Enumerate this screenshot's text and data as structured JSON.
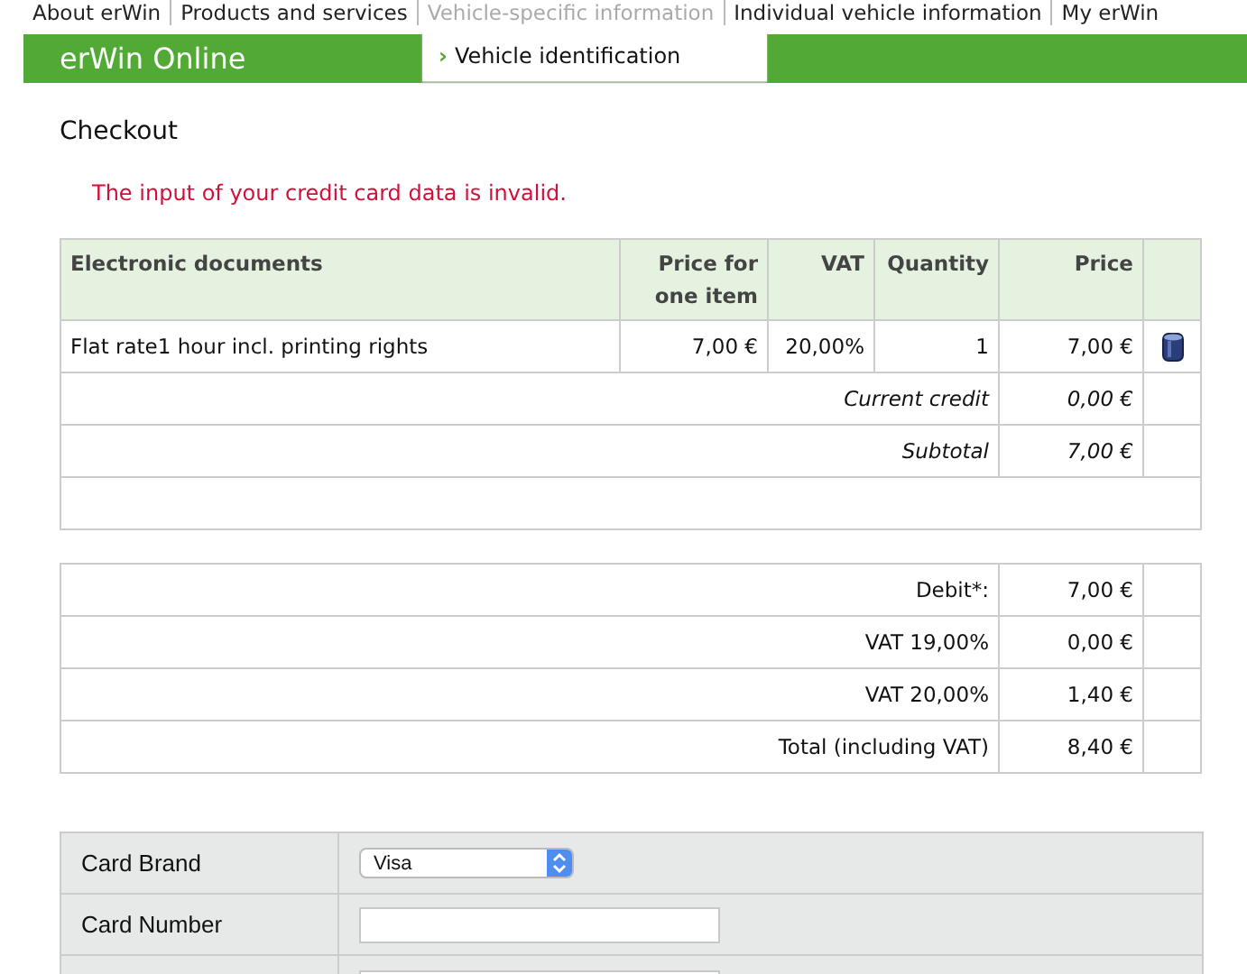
{
  "top_nav": [
    {
      "label": "About erWin",
      "selected": false
    },
    {
      "label": "Products and services",
      "selected": false
    },
    {
      "label": "Vehicle-specific information",
      "selected": true
    },
    {
      "label": "Individual vehicle information",
      "selected": false
    },
    {
      "label": "My erWin",
      "selected": false
    }
  ],
  "header": {
    "title": "erWin Online",
    "dropdown_marker": "›",
    "dropdown_item": "Vehicle identification"
  },
  "page_title": "Checkout",
  "error": "The input of your credit card data is invalid.",
  "cart_table": {
    "columns": [
      "Electronic documents",
      "Price for one item",
      "VAT",
      "Quantity",
      "Price"
    ],
    "rows": [
      {
        "description": "Flat rate1 hour incl. printing rights",
        "unit_price": "7,00 €",
        "vat": "20,00%",
        "quantity": "1",
        "price": "7,00 €"
      }
    ],
    "summary_rows": [
      {
        "label": "Current credit",
        "value": "0,00 €"
      },
      {
        "label": "Subtotal",
        "value": "7,00 €"
      }
    ]
  },
  "totals_table": {
    "rows": [
      {
        "label": "Debit*:",
        "value": "7,00 €"
      },
      {
        "label": "VAT 19,00%",
        "value": "0,00 €"
      },
      {
        "label": "VAT 20,00%",
        "value": "1,40 €"
      },
      {
        "label": "Total (including VAT)",
        "value": "8,40 €"
      }
    ]
  },
  "payment_form": {
    "fields": [
      {
        "kind": "select",
        "label": "Card Brand",
        "value": "Visa"
      },
      {
        "kind": "text",
        "label": "Card Number"
      },
      {
        "kind": "text"
      }
    ]
  }
}
